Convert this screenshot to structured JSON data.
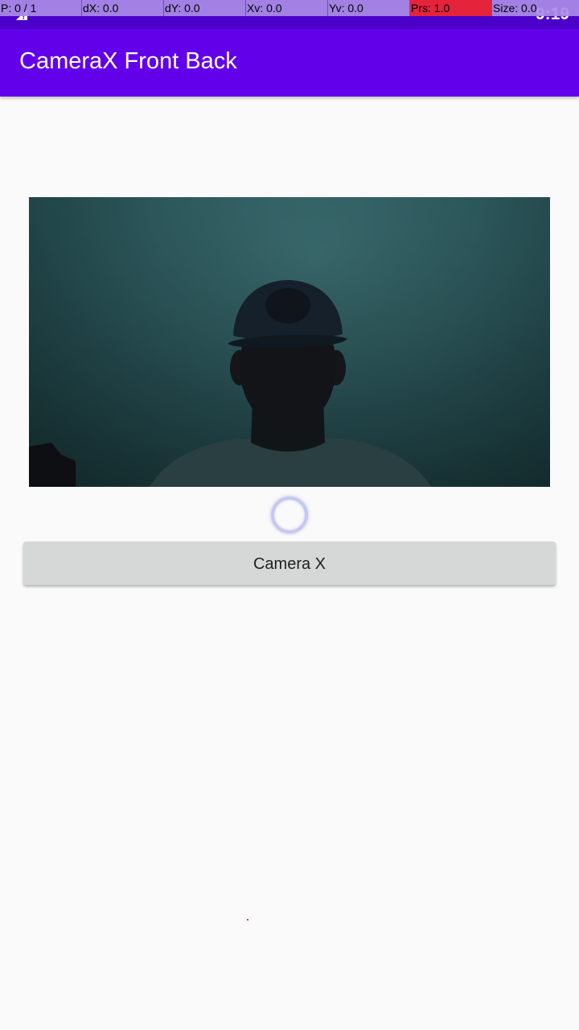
{
  "status_bar": {
    "time": "9:19",
    "background_color": "#4a00c9",
    "left_icon": "sim-alert-icon"
  },
  "pointer_overlay": {
    "cells": [
      {
        "text": "P: 0 / 1"
      },
      {
        "text": "dX: 0.0"
      },
      {
        "text": "dY: 0.0"
      },
      {
        "text": "Xv: 0.0"
      },
      {
        "text": "Yv: 0.0"
      },
      {
        "text": "Prs: 1.0"
      },
      {
        "text": "Size: 0.0"
      }
    ]
  },
  "app_bar": {
    "title": "CameraX Front Back",
    "color": "#6200ea"
  },
  "preview": {
    "icon": "camera-preview-image"
  },
  "spinner": {
    "icon": "loading-spinner-icon"
  },
  "main_button": {
    "label": "Camera X"
  }
}
